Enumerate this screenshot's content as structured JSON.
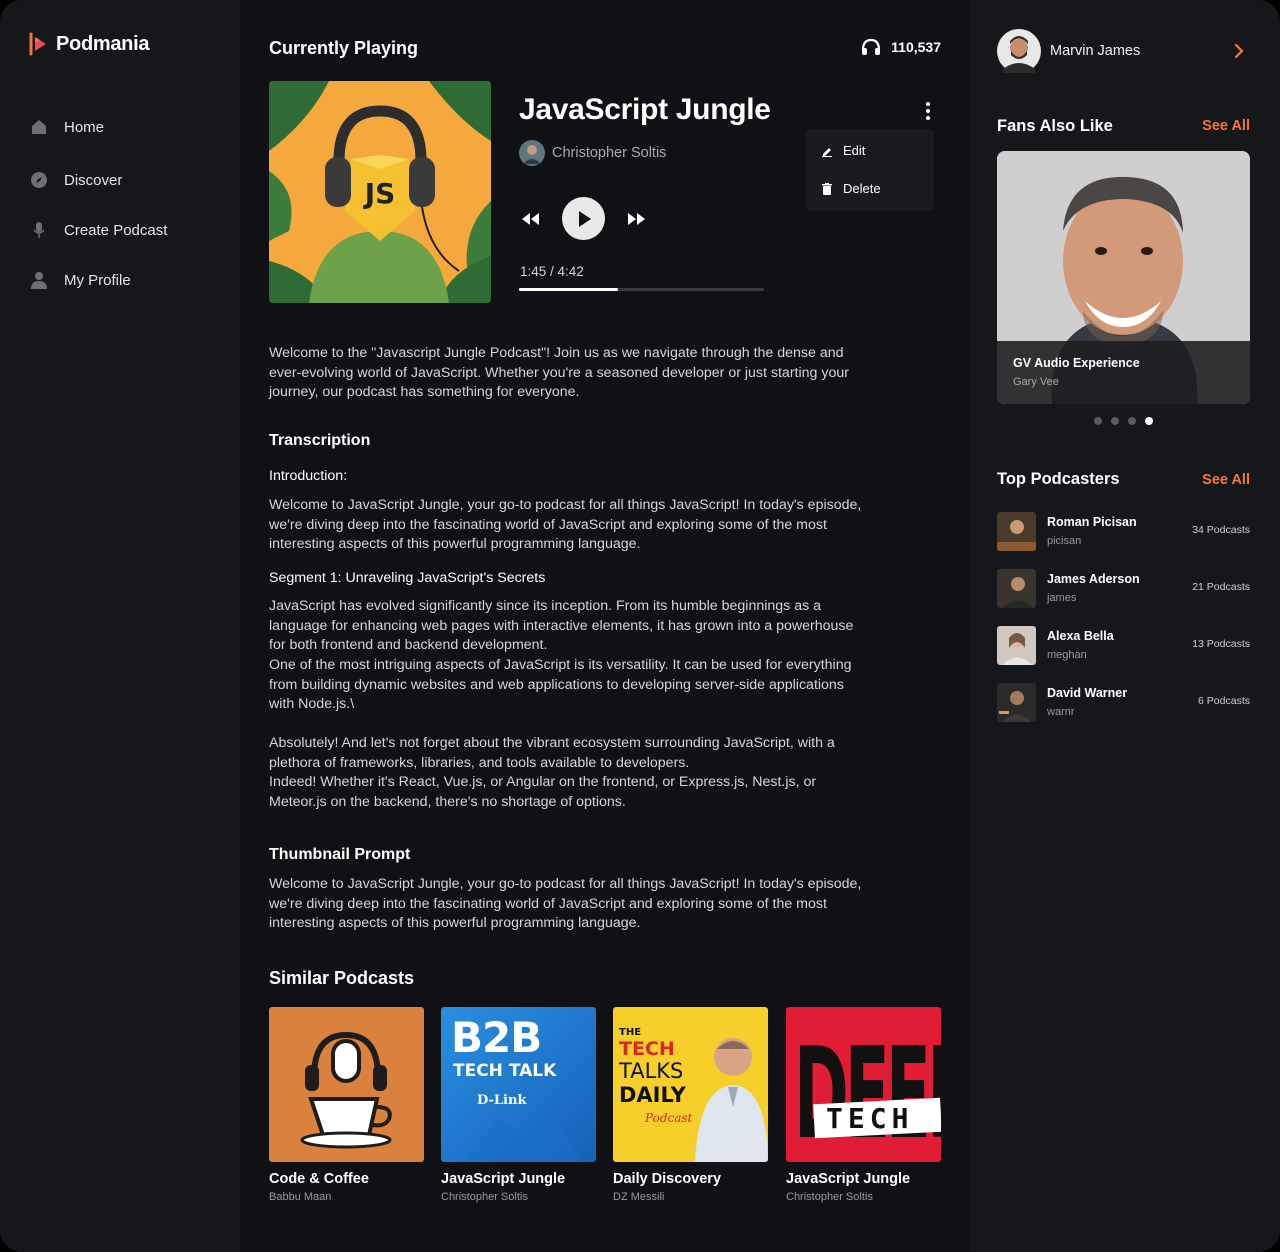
{
  "app": {
    "name": "Podmania"
  },
  "nav": [
    {
      "label": "Home",
      "icon": "home-icon"
    },
    {
      "label": "Discover",
      "icon": "compass-icon"
    },
    {
      "label": "Create Podcast",
      "icon": "microphone-icon"
    },
    {
      "label": "My Profile",
      "icon": "user-icon"
    }
  ],
  "player": {
    "heading": "Currently Playing",
    "listeners": "110,537",
    "title": "JavaScript Jungle",
    "author": "Christopher Soltis",
    "time": "1:45 / 4:42",
    "progress": 0.405,
    "art_text": "JS",
    "menu": {
      "edit": "Edit",
      "delete": "Delete"
    }
  },
  "description": "Welcome to the \"Javascript Jungle Podcast\"! Join us as we navigate through the dense and ever-evolving world of JavaScript. Whether you're a seasoned developer or just starting your journey, our podcast has something for everyone.",
  "transcription": {
    "heading": "Transcription",
    "intro_heading": "Introduction:",
    "intro_text": "Welcome to JavaScript Jungle, your go-to podcast for all things JavaScript! In today's episode, we're diving deep into the fascinating world of JavaScript and exploring some of the most interesting aspects of this powerful programming language.",
    "segment_heading": "Segment 1: Unraveling JavaScript's Secrets",
    "segment_p1": "JavaScript has evolved significantly since its inception. From its humble beginnings as a language for enhancing web pages with interactive elements, it has grown into a powerhouse for both frontend and backend development.",
    "segment_p2": "One of the most intriguing aspects of JavaScript is its versatility. It can be used for everything from building dynamic websites and web applications to developing server-side applications with Node.js.\\",
    "segment_p3": "Absolutely! And let's not forget about the vibrant ecosystem surrounding JavaScript, with a plethora of frameworks, libraries, and tools available to developers.",
    "segment_p4": "Indeed! Whether it's React, Vue.js, or Angular on the frontend, or Express.js, Nest.js, or Meteor.js on the backend, there's no shortage of options."
  },
  "thumbnail_prompt": {
    "heading": "Thumbnail Prompt",
    "text": "Welcome to JavaScript Jungle, your go-to podcast for all things JavaScript! In today's episode, we're diving deep into the fascinating world of JavaScript and exploring some of the most interesting aspects of this powerful programming language."
  },
  "similar": {
    "heading": "Similar Podcasts",
    "items": [
      {
        "title": "Code & Coffee",
        "author": "Babbu Maan"
      },
      {
        "title": "JavaScript Jungle",
        "author": "Christopher Soltis",
        "cover_line1": "B2B",
        "cover_line2": "TECH TALK",
        "cover_line3": "D-Link"
      },
      {
        "title": "Daily Discovery",
        "author": "DZ Messili",
        "cover_line1": "THE",
        "cover_line2": "TECH",
        "cover_line3": "TALKS",
        "cover_line4": "DAILY",
        "cover_line5": "Podcast"
      },
      {
        "title": "JavaScript Jungle",
        "author": "Christopher Soltis",
        "cover_line1": "DEEP",
        "cover_line2": "TECH"
      }
    ]
  },
  "user": {
    "name": "Marvin James"
  },
  "fans": {
    "heading": "Fans Also Like",
    "see_all": "See All",
    "featured_title": "GV Audio Experience",
    "featured_author": "Gary Vee",
    "active_dot": 3,
    "dot_count": 4
  },
  "top": {
    "heading": "Top Podcasters",
    "see_all": "See All",
    "items": [
      {
        "name": "Roman Picisan",
        "user": "picisan",
        "count": "34 Podcasts"
      },
      {
        "name": "James Aderson",
        "user": "james",
        "count": "21 Podcasts"
      },
      {
        "name": "Alexa Bella",
        "user": "meghan",
        "count": "13 Podcasts"
      },
      {
        "name": "David Warner",
        "user": "warnr",
        "count": "6 Podcasts"
      }
    ]
  },
  "colors": {
    "accent": "#f97535",
    "background": "#101114",
    "panel": "#16171b"
  }
}
